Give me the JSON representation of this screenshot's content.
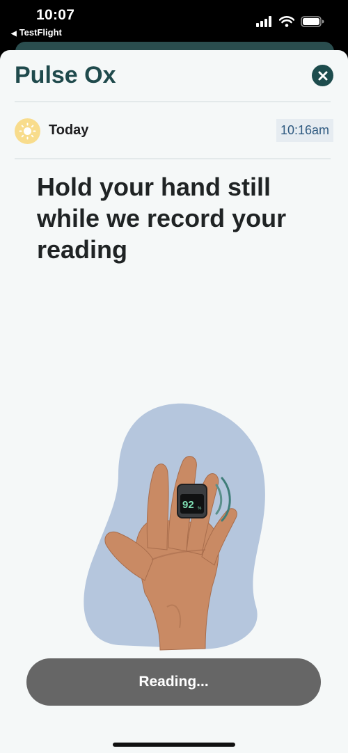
{
  "status_bar": {
    "time": "10:07",
    "back_app": "TestFlight"
  },
  "header": {
    "title": "Pulse Ox"
  },
  "day_row": {
    "label": "Today",
    "time": "10:16am"
  },
  "instruction": "Hold your hand still while we record your reading",
  "device": {
    "value": "92",
    "unit": "%"
  },
  "button": {
    "label": "Reading..."
  },
  "colors": {
    "title": "#1f4a4c",
    "close_button": "#1d4c4d",
    "sun_badge": "#f8dc8c",
    "blob": "#b5c6dd",
    "skin": "#c98a64",
    "button": "#666666"
  },
  "icons": [
    "back-arrow-icon",
    "signal-icon",
    "wifi-icon",
    "battery-icon",
    "close-icon",
    "sun-icon"
  ]
}
